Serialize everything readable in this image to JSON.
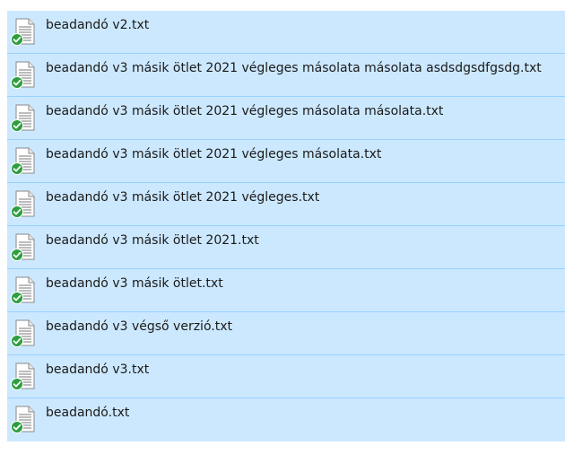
{
  "files": [
    {
      "name": "beadandó v2.txt",
      "icon": "text-file-icon",
      "status": "synced-check-icon"
    },
    {
      "name": "beadandó v3 másik ötlet 2021 végleges másolata másolata asdsdgsdfgsdg.txt",
      "icon": "text-file-icon",
      "status": "synced-check-icon"
    },
    {
      "name": "beadandó v3 másik ötlet 2021 végleges másolata másolata.txt",
      "icon": "text-file-icon",
      "status": "synced-check-icon"
    },
    {
      "name": "beadandó v3 másik ötlet 2021 végleges másolata.txt",
      "icon": "text-file-icon",
      "status": "synced-check-icon"
    },
    {
      "name": "beadandó v3 másik ötlet 2021 végleges.txt",
      "icon": "text-file-icon",
      "status": "synced-check-icon"
    },
    {
      "name": "beadandó v3 másik ötlet 2021.txt",
      "icon": "text-file-icon",
      "status": "synced-check-icon"
    },
    {
      "name": "beadandó v3 másik ötlet.txt",
      "icon": "text-file-icon",
      "status": "synced-check-icon"
    },
    {
      "name": "beadandó v3 végső verzió.txt",
      "icon": "text-file-icon",
      "status": "synced-check-icon"
    },
    {
      "name": "beadandó v3.txt",
      "icon": "text-file-icon",
      "status": "synced-check-icon"
    },
    {
      "name": "beadandó.txt",
      "icon": "text-file-icon",
      "status": "synced-check-icon"
    }
  ],
  "colors": {
    "row_selected_bg": "#cce8ff",
    "row_border": "#99d1ff",
    "status_green": "#2e9e3e"
  }
}
